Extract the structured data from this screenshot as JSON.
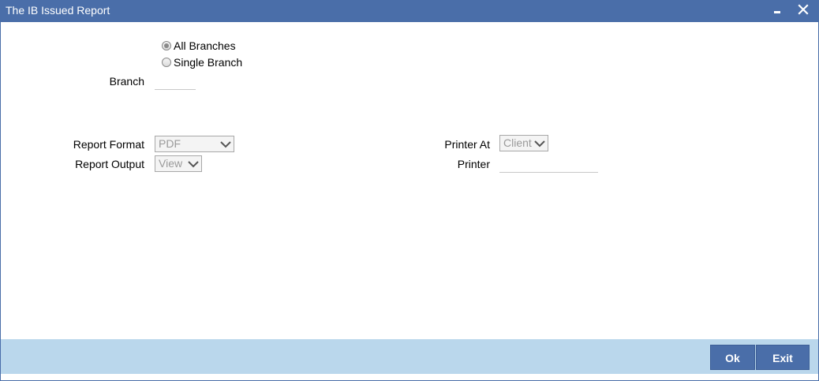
{
  "window": {
    "title": "The IB Issued Report"
  },
  "branch_selection": {
    "options": [
      {
        "label": "All Branches",
        "selected": true
      },
      {
        "label": "Single Branch",
        "selected": false
      }
    ],
    "branch_label": "Branch",
    "branch_value": ""
  },
  "report": {
    "format_label": "Report Format",
    "format_value": "PDF",
    "output_label": "Report Output",
    "output_value": "View"
  },
  "printer": {
    "at_label": "Printer At",
    "at_value": "Client",
    "printer_label": "Printer",
    "printer_value": ""
  },
  "footer": {
    "ok_label": "Ok",
    "exit_label": "Exit"
  },
  "colors": {
    "titlebar": "#4a6ea9",
    "footer": "#bad7ec",
    "button": "#4a6ea9"
  }
}
